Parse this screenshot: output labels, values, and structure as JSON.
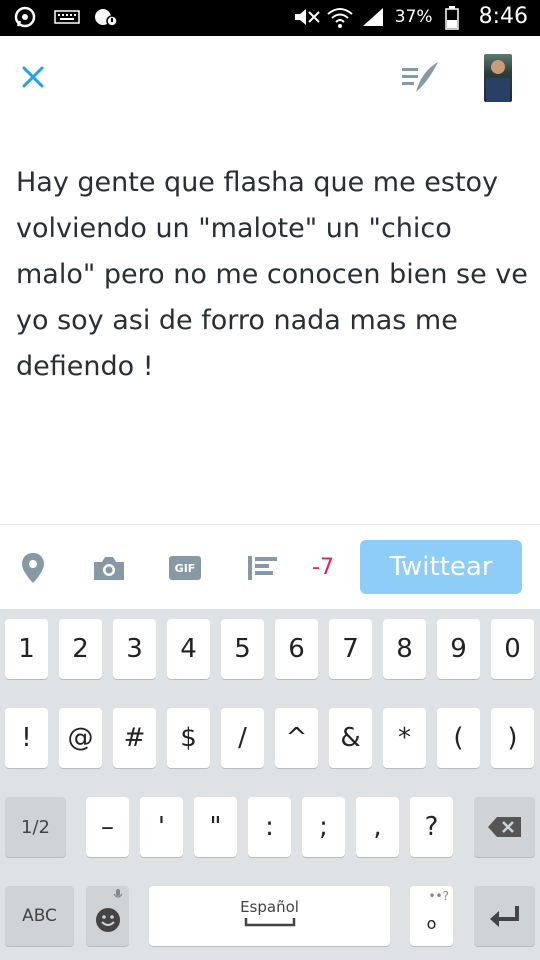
{
  "status_bar": {
    "battery_percent": "37%",
    "time": "8:46"
  },
  "compose": {
    "close_icon": "close-icon",
    "drafts_icon": "drafts-icon",
    "tweet_text": "Hay gente que flasha que me estoy volviendo un \"malote\" un \"chico malo\" pero no me conocen bien se ve yo  soy asi de forro nada mas me defiendo !"
  },
  "toolbar": {
    "location_icon": "location-pin-icon",
    "camera_icon": "camera-icon",
    "gif_label": "GIF",
    "poll_icon": "poll-icon",
    "char_counter": "-7",
    "tweet_button_label": "Twittear"
  },
  "keyboard": {
    "row1": [
      "1",
      "2",
      "3",
      "4",
      "5",
      "6",
      "7",
      "8",
      "9",
      "0"
    ],
    "row2": [
      "!",
      "@",
      "#",
      "$",
      "/",
      "^",
      "&",
      "*",
      "(",
      ")"
    ],
    "row3": [
      "1/2",
      "–",
      "'",
      "\"",
      ":",
      ";",
      ",",
      "?"
    ],
    "row4": {
      "abc": "ABC",
      "space_label": "Español",
      "period_sub": "••?",
      "period": "o"
    }
  }
}
